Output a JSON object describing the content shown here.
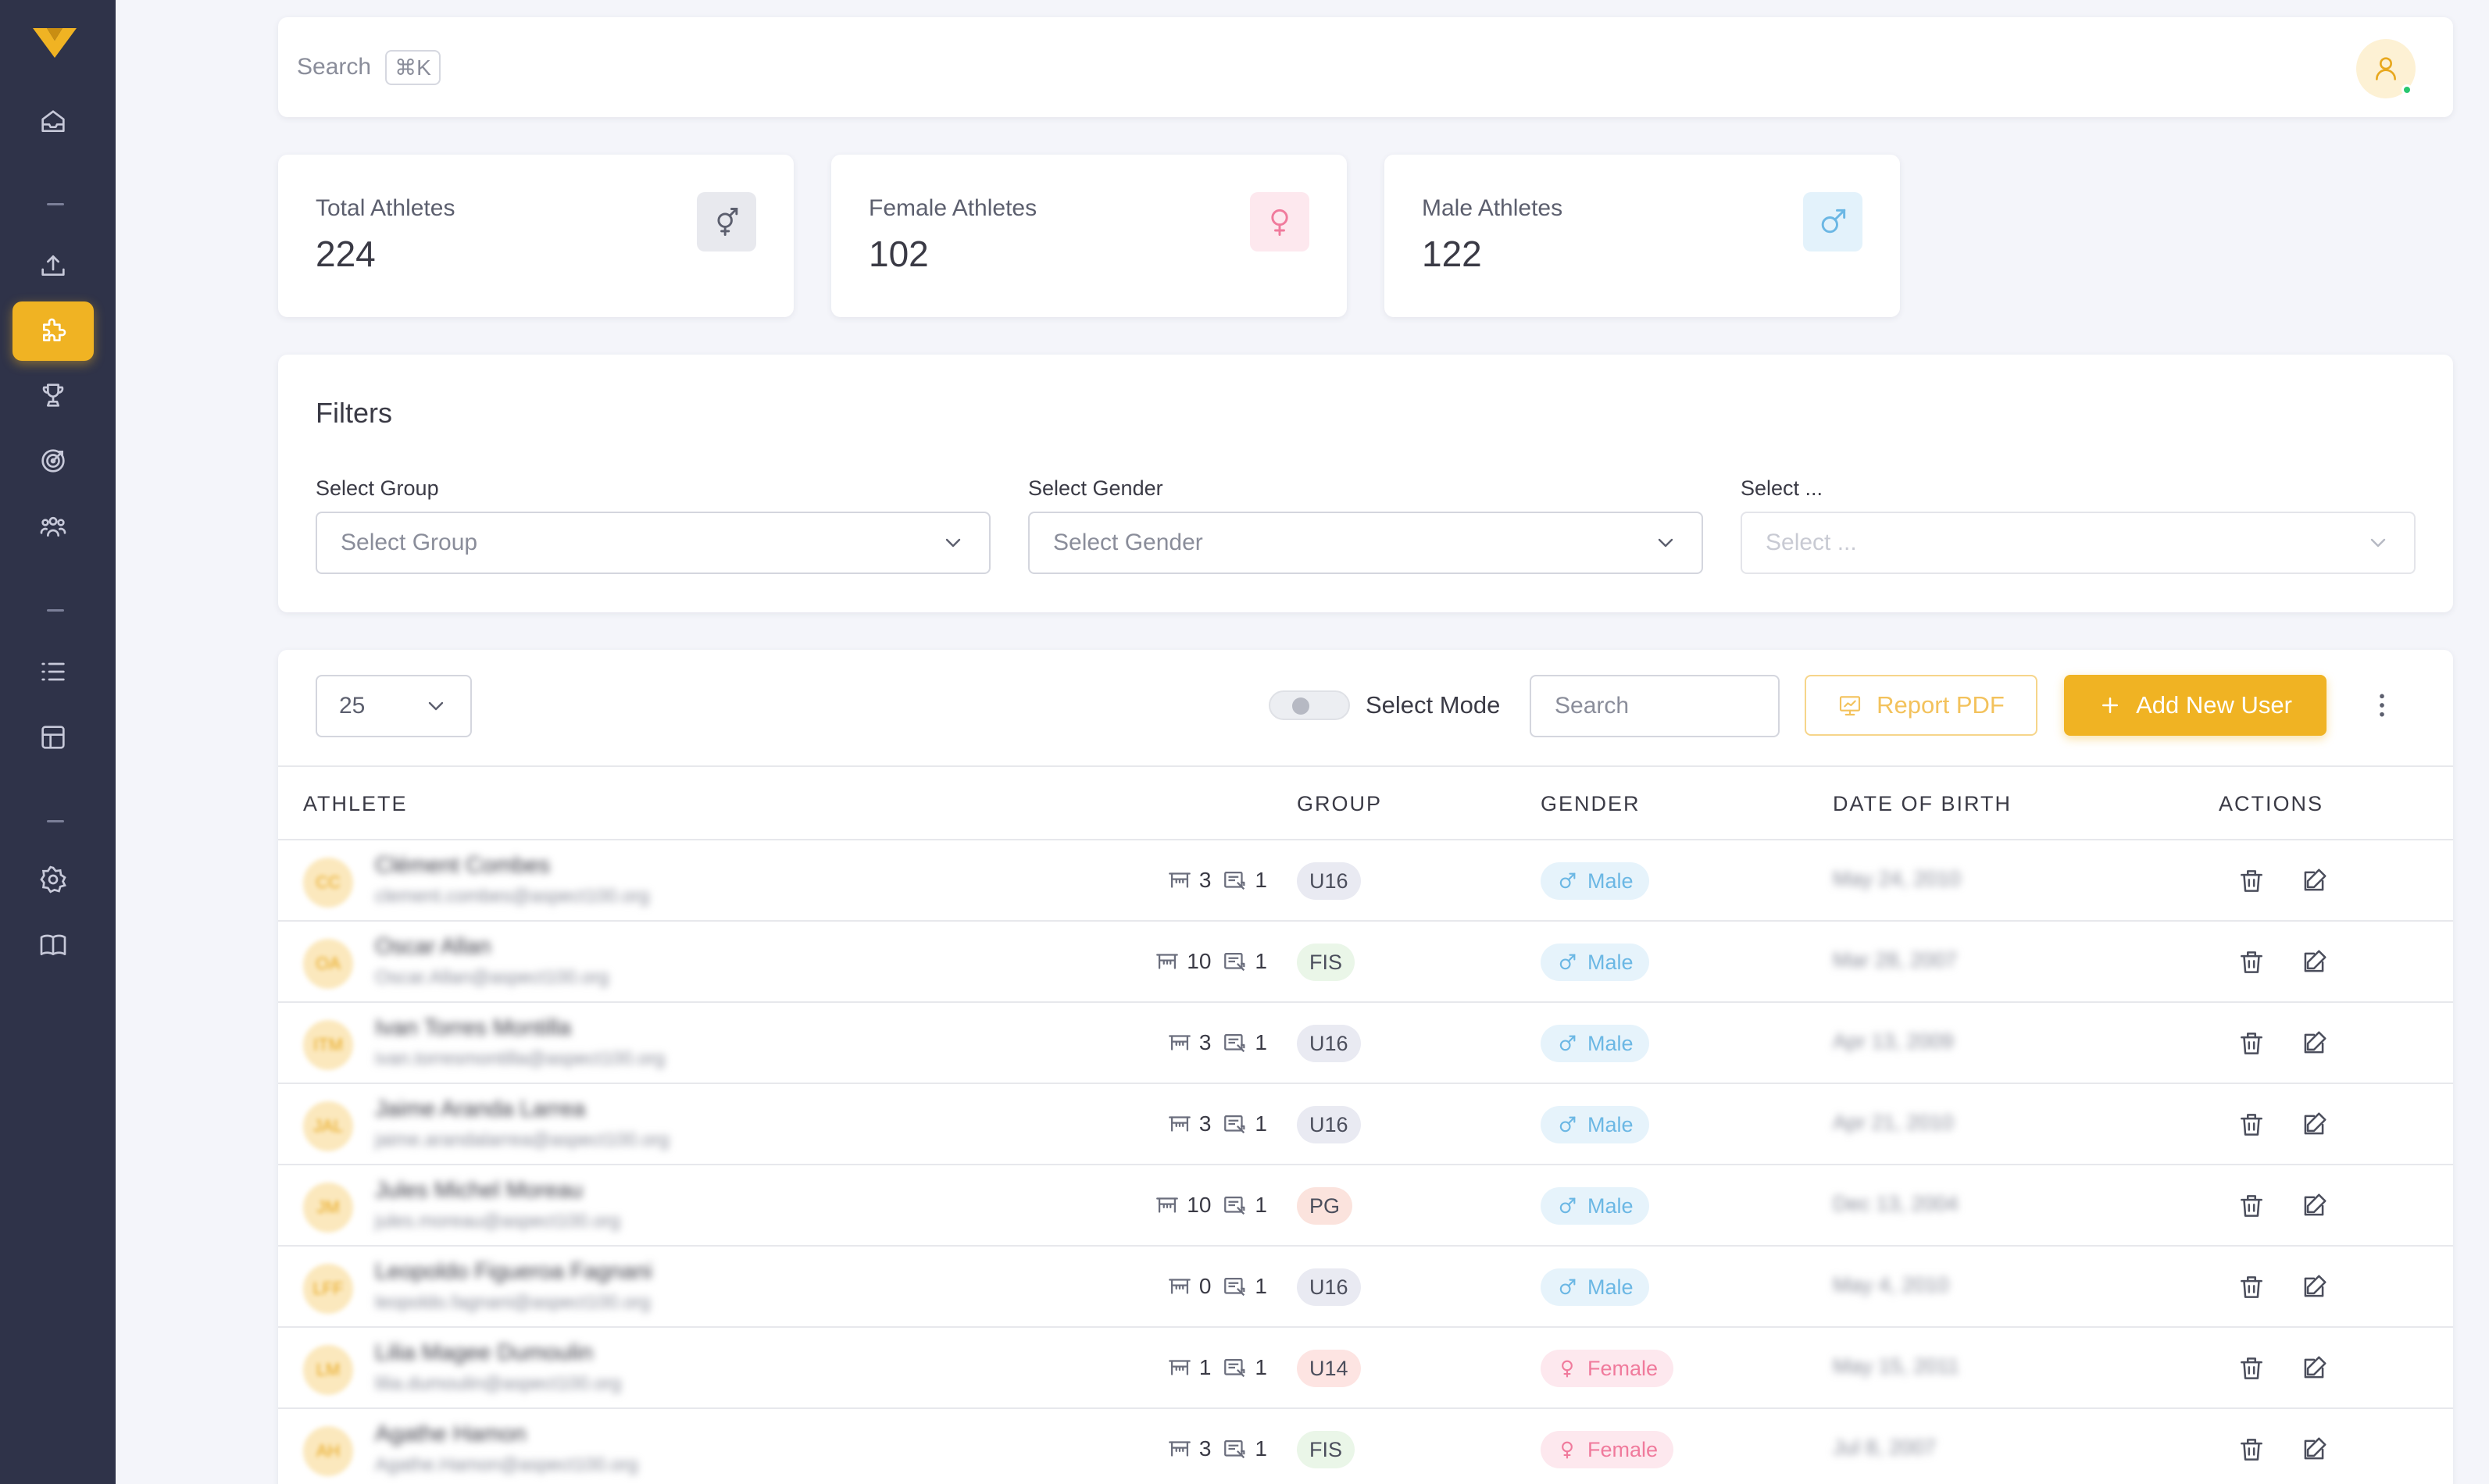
{
  "topbar": {
    "search_label": "Search",
    "shortcut": "⌘K"
  },
  "stats": {
    "total": {
      "label": "Total Athletes",
      "value": "224"
    },
    "female": {
      "label": "Female Athletes",
      "value": "102"
    },
    "male": {
      "label": "Male Athletes",
      "value": "122"
    }
  },
  "filters": {
    "title": "Filters",
    "group": {
      "label": "Select Group",
      "placeholder": "Select Group"
    },
    "gender": {
      "label": "Select Gender",
      "placeholder": "Select Gender"
    },
    "other": {
      "label": "Select ...",
      "placeholder": "Select ..."
    }
  },
  "toolbar": {
    "page_size": "25",
    "select_mode_label": "Select Mode",
    "search_placeholder": "Search",
    "report_label": "Report PDF",
    "add_label": "Add New User"
  },
  "table": {
    "columns": {
      "athlete": "ATHLETE",
      "group": "GROUP",
      "gender": "GENDER",
      "dob": "DATE OF BIRTH",
      "actions": "ACTIONS"
    },
    "rows": [
      {
        "initials": "CC",
        "name": "Clément Combes",
        "email": "clement.combes@aspect100.org",
        "races": "3",
        "cards": "1",
        "group": "U16",
        "gender": "Male",
        "dob": "May 24, 2010"
      },
      {
        "initials": "OA",
        "name": "Oscar Allan",
        "email": "Oscar.Allan@aspect100.org",
        "races": "10",
        "cards": "1",
        "group": "FIS",
        "gender": "Male",
        "dob": "Mar 28, 2007"
      },
      {
        "initials": "ITM",
        "name": "Ivan Torres Montilla",
        "email": "ivan.torresmontilla@aspect100.org",
        "races": "3",
        "cards": "1",
        "group": "U16",
        "gender": "Male",
        "dob": "Apr 13, 2009"
      },
      {
        "initials": "JAL",
        "name": "Jaime Aranda Larrea",
        "email": "jaime.arandalarrea@aspect100.org",
        "races": "3",
        "cards": "1",
        "group": "U16",
        "gender": "Male",
        "dob": "Apr 21, 2010"
      },
      {
        "initials": "JM",
        "name": "Jules Michel Moreau",
        "email": "jules.moreau@aspect100.org",
        "races": "10",
        "cards": "1",
        "group": "PG",
        "gender": "Male",
        "dob": "Dec 13, 2004"
      },
      {
        "initials": "LFF",
        "name": "Leopoldo Figueroa Fagnani",
        "email": "leopoldo.fagnani@aspect100.org",
        "races": "0",
        "cards": "1",
        "group": "U16",
        "gender": "Male",
        "dob": "May 4, 2010"
      },
      {
        "initials": "LM",
        "name": "Lilia Magee Dumoulin",
        "email": "lilia.dumoulin@aspect100.org",
        "races": "1",
        "cards": "1",
        "group": "U14",
        "gender": "Female",
        "dob": "May 15, 2011"
      },
      {
        "initials": "AH",
        "name": "Agathe Hamon",
        "email": "Agathe.Hamon@aspect100.org",
        "races": "3",
        "cards": "1",
        "group": "FIS",
        "gender": "Female",
        "dob": "Jul 8, 2007"
      }
    ]
  },
  "colors": {
    "accent": "#f0b323",
    "sidebar": "#2f3349",
    "male": "#6bb7e4",
    "female": "#f07a9c",
    "chip_u16": "#e9eaf2",
    "chip_fis": "#eaf6e8",
    "chip_pg": "#fbe3dd",
    "chip_u14": "#fde4e2"
  }
}
